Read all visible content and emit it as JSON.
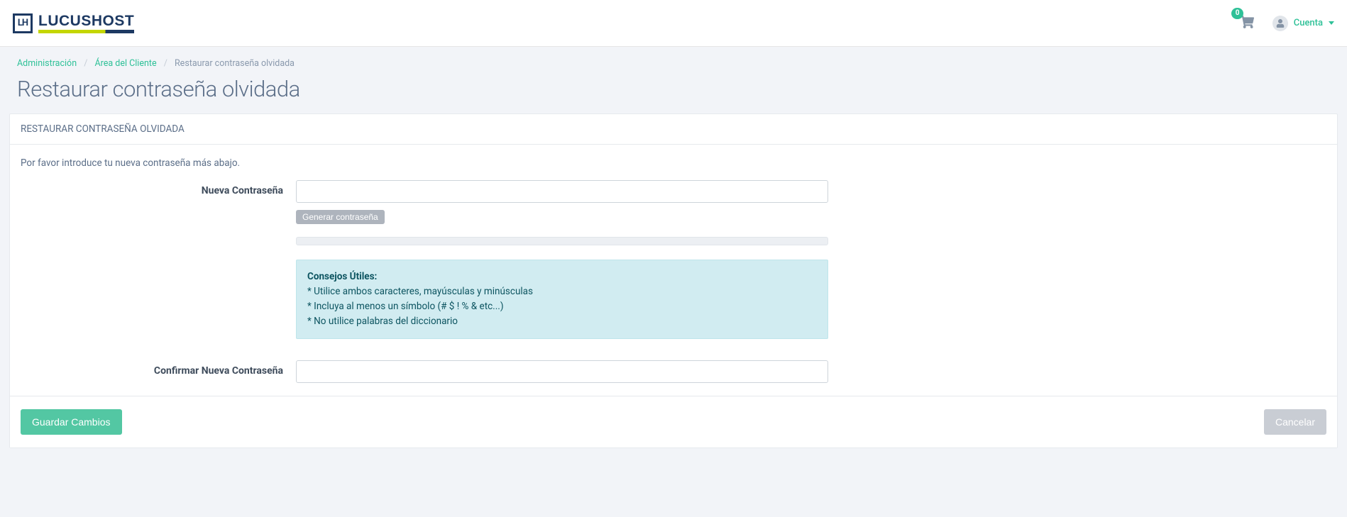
{
  "logo": {
    "boxText": "LH",
    "brandA": "L",
    "brandB": "UCUS",
    "brandC": "H",
    "brandD": "OST"
  },
  "header": {
    "cartCount": "0",
    "accountLabel": "Cuenta"
  },
  "breadcrumb": {
    "a": "Administración",
    "b": "Área del Cliente",
    "c": "Restaurar contraseña olvidada"
  },
  "page": {
    "title": "Restaurar contraseña olvidada",
    "panelHead": "RESTAURAR CONTRASEÑA OLVIDADA",
    "intro": "Por favor introduce tu nueva contraseña más abajo."
  },
  "form": {
    "newPassLabel": "Nueva Contraseña",
    "genBtn": "Generar contraseña",
    "tipsTitle": "Consejos Útiles:",
    "tip1": "* Utilice ambos caracteres, mayúsculas y minúsculas",
    "tip2": "* Incluya al menos un símbolo (# $ ! % & etc...)",
    "tip3": "* No utilice palabras del diccionario",
    "confirmLabel": "Confirmar Nueva Contraseña"
  },
  "footer": {
    "save": "Guardar Cambios",
    "cancel": "Cancelar"
  }
}
